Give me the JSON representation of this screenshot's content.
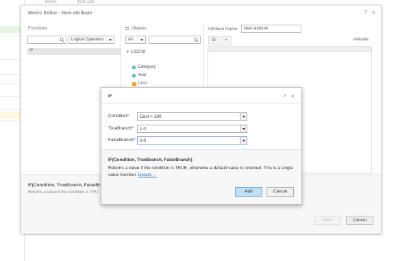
{
  "background": {
    "top_left_text": "Books",
    "top_right_text": "$510,236"
  },
  "editor": {
    "title": "Metric Editor - New attribute",
    "help": "?",
    "close": "×",
    "functions_label": "Functions",
    "functions_search_placeholder": "",
    "functions_category": "Logical Operators",
    "functions_list": [
      "IF"
    ],
    "objects_label": "Objects",
    "objects_filter": "All",
    "objects_search_placeholder": "",
    "tree_root": "132218",
    "tree_items": [
      "Category",
      "Year",
      "Cost"
    ],
    "attribute_name_label": "Attribute Name",
    "attribute_name_value": "New attribute",
    "tab_id": "ID",
    "tab_add": "+",
    "validate": "Validate",
    "bottom_function": "IF(Condition, TrueBranch, FalseBranch)",
    "bottom_description": "Returns a value if the condition is TRU",
    "save_button": "Save",
    "cancel_button": "Cancel"
  },
  "if_dialog": {
    "title": "IF",
    "help": "?",
    "close": "×",
    "condition_label": "Condition*:",
    "condition_value": "Cost > 100",
    "truebranch_label": "TrueBranch*:",
    "truebranch_value": "1.0",
    "falsebranch_label": "FalseBranch*:",
    "falsebranch_value": "0.0",
    "syntax": "IF(Condition, TrueBranch, FalseBranch)",
    "description": "Returns a value if the condition is TRUE, otherwise a default value is returned. This is a single value function.",
    "details_link": "Details ...",
    "add_button": "Add",
    "cancel_button": "Cancel"
  }
}
